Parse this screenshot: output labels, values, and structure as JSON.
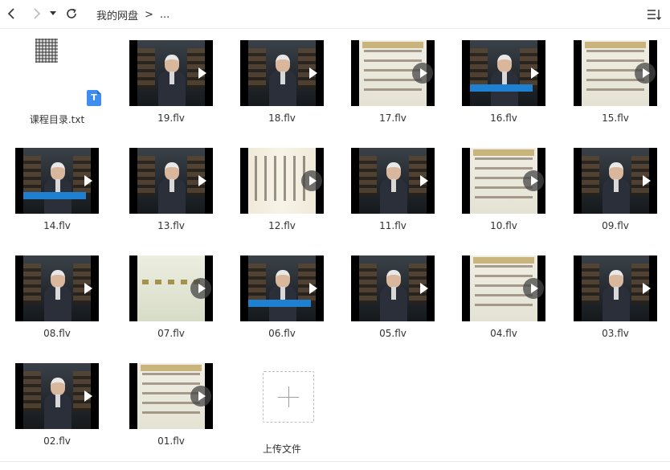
{
  "toolbar": {
    "breadcrumb_root": "我的网盘",
    "breadcrumb_sep": ">",
    "breadcrumb_more": "..."
  },
  "files": [
    {
      "name": "课程目录.txt",
      "kind": "txt"
    },
    {
      "name": "19.flv",
      "kind": "video",
      "style": "lecture"
    },
    {
      "name": "18.flv",
      "kind": "video",
      "style": "lecture"
    },
    {
      "name": "17.flv",
      "kind": "video",
      "style": "slide"
    },
    {
      "name": "16.flv",
      "kind": "video",
      "style": "lecture-banner"
    },
    {
      "name": "15.flv",
      "kind": "video",
      "style": "slide"
    },
    {
      "name": "14.flv",
      "kind": "video",
      "style": "lecture-banner"
    },
    {
      "name": "13.flv",
      "kind": "video",
      "style": "lecture"
    },
    {
      "name": "12.flv",
      "kind": "video",
      "style": "scroll"
    },
    {
      "name": "11.flv",
      "kind": "video",
      "style": "lecture"
    },
    {
      "name": "10.flv",
      "kind": "video",
      "style": "slide"
    },
    {
      "name": "09.flv",
      "kind": "video",
      "style": "lecture"
    },
    {
      "name": "08.flv",
      "kind": "video",
      "style": "lecture"
    },
    {
      "name": "07.flv",
      "kind": "video",
      "style": "ink"
    },
    {
      "name": "06.flv",
      "kind": "video",
      "style": "lecture-banner"
    },
    {
      "name": "05.flv",
      "kind": "video",
      "style": "lecture"
    },
    {
      "name": "04.flv",
      "kind": "video",
      "style": "slide"
    },
    {
      "name": "03.flv",
      "kind": "video",
      "style": "lecture"
    },
    {
      "name": "02.flv",
      "kind": "video",
      "style": "lecture"
    },
    {
      "name": "01.flv",
      "kind": "video",
      "style": "slide"
    }
  ],
  "upload": {
    "label": "上传文件"
  },
  "colors": {
    "accent": "#3d8ef0",
    "banner": "#1f7fd0"
  }
}
